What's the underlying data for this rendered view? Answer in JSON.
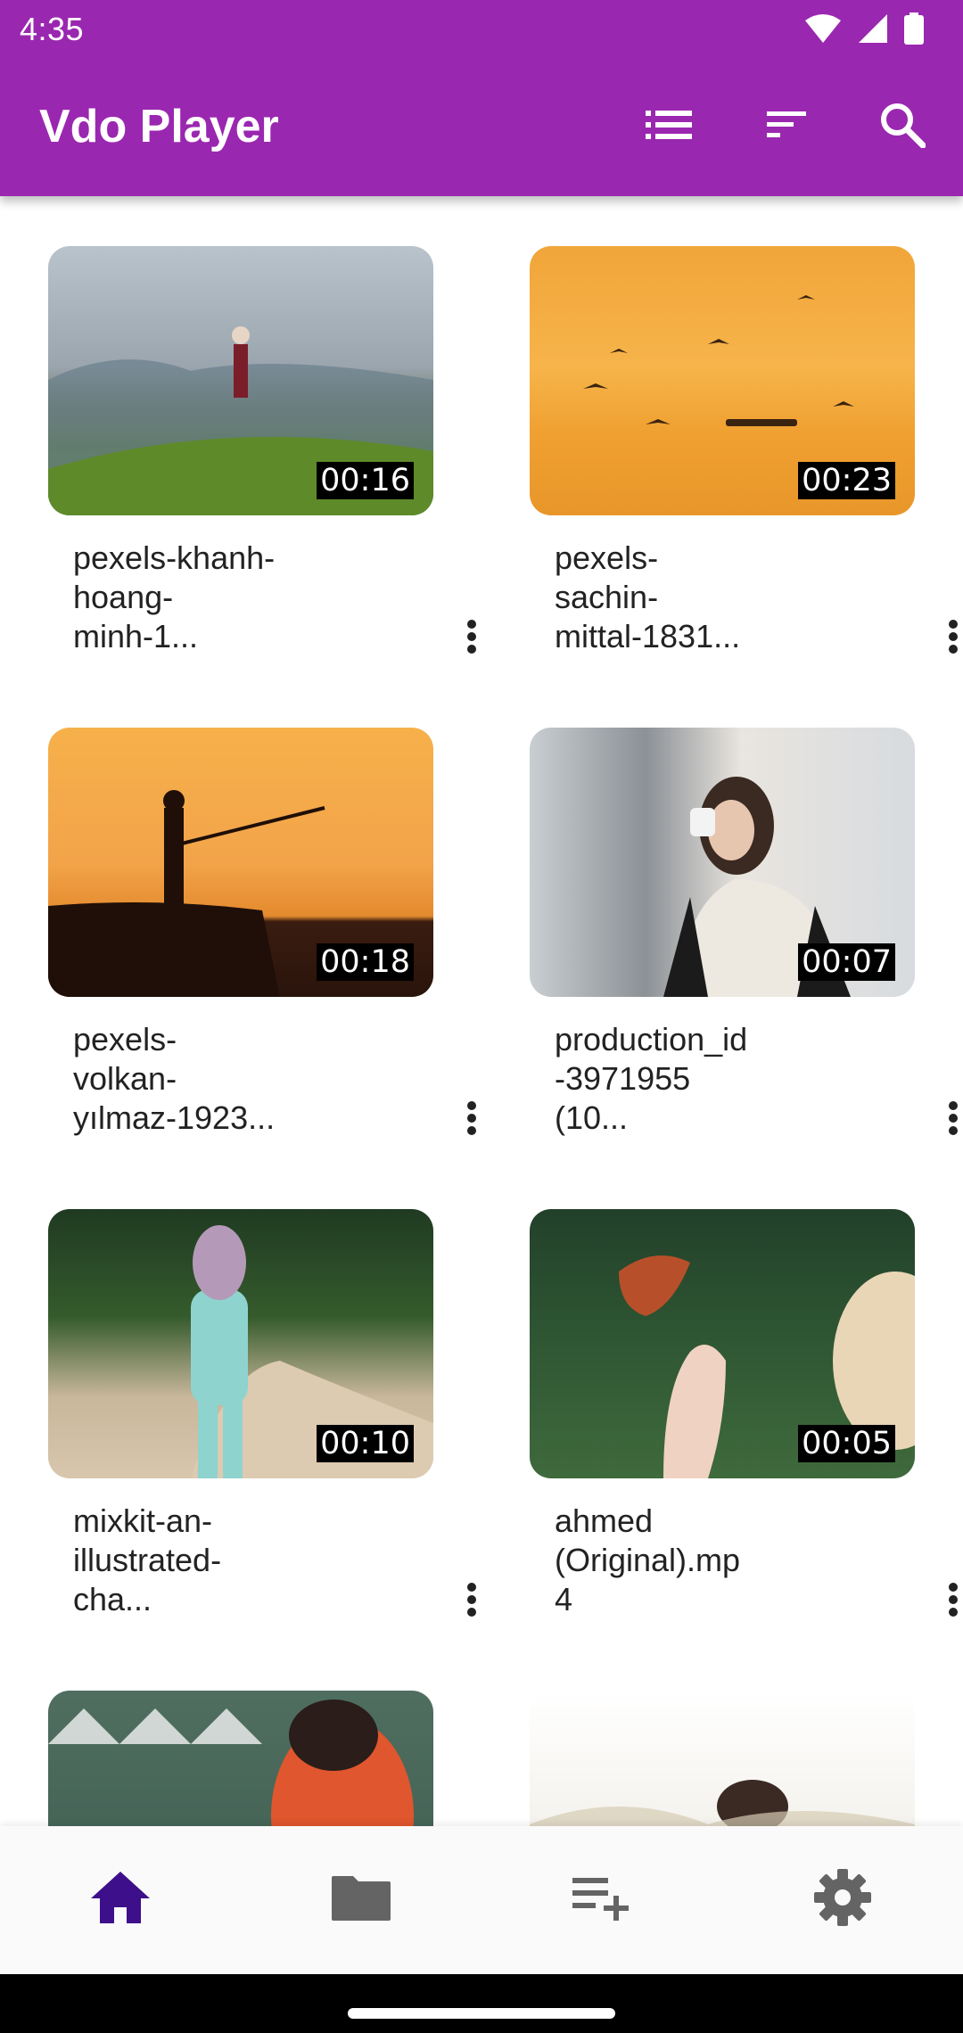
{
  "status_bar": {
    "time": "4:35"
  },
  "app_bar": {
    "title": "Vdo Player",
    "actions": [
      "list-view-icon",
      "sort-icon",
      "search-icon"
    ]
  },
  "colors": {
    "primary": "#9a27b0",
    "nav_selected": "#3d0f8a",
    "nav_unselected": "#646464"
  },
  "videos": [
    {
      "title": "pexels-khanh-\nhoang-\nminh-1...",
      "duration": "00:16"
    },
    {
      "title": "pexels-\nsachin-\nmittal-1831...",
      "duration": "00:23"
    },
    {
      "title": "pexels-\nvolkan-\nyılmaz-1923...",
      "duration": "00:18"
    },
    {
      "title": "production_id\n-3971955\n(10...",
      "duration": "00:07"
    },
    {
      "title": "mixkit-an-\nillustrated-\ncha...",
      "duration": "00:10"
    },
    {
      "title": "ahmed\n(Original).mp\n4",
      "duration": "00:05"
    }
  ],
  "bottom_nav": [
    {
      "icon": "home-icon",
      "selected": true
    },
    {
      "icon": "folder-icon",
      "selected": false
    },
    {
      "icon": "playlist-add-icon",
      "selected": false
    },
    {
      "icon": "settings-icon",
      "selected": false
    }
  ]
}
